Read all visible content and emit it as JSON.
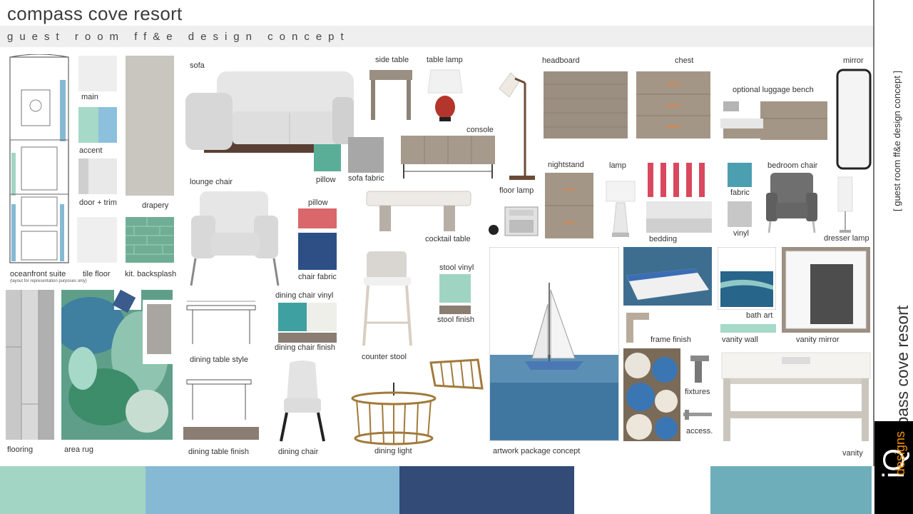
{
  "header": {
    "title": "compass cove resort",
    "subtitle": "guest room ff&e design concept"
  },
  "side": {
    "title": "compass cove resort",
    "subtitle": "[ guest room ff&e design concept ]",
    "logo_main": "iQ",
    "logo_sub": "designs"
  },
  "labels": {
    "main": "main",
    "accent": "accent",
    "door_trim": "door + trim",
    "drapery": "drapery",
    "tile_floor": "tile floor",
    "kit_backsplash": "kit. backsplash",
    "oceanfront_suite": "oceanfront suite",
    "layout_note": "(layout for representation purposes only)",
    "flooring": "flooring",
    "area_rug": "area rug",
    "sofa": "sofa",
    "pillow": "pillow",
    "sofa_fabric": "sofa fabric",
    "lounge_chair": "lounge chair",
    "pillow2": "pillow",
    "chair_fabric": "chair fabric",
    "side_table": "side table",
    "table_lamp": "table lamp",
    "console": "console",
    "cocktail_table": "cocktail table",
    "floor_lamp": "floor lamp",
    "headboard": "headboard",
    "chest": "chest",
    "optional_luggage_bench": "optional luggage bench",
    "mirror": "mirror",
    "nightstand": "nightstand",
    "lamp": "lamp",
    "bedding": "bedding",
    "fabric": "fabric",
    "vinyl": "vinyl",
    "bedroom_chair": "bedroom chair",
    "dresser_lamp": "dresser lamp",
    "dining_table_style": "dining table style",
    "dining_chair_vinyl": "dining chair vinyl",
    "dining_chair_finish": "dining chair finish",
    "dining_table_finish": "dining table finish",
    "dining_chair": "dining chair",
    "stool_vinyl": "stool vinyl",
    "stool_finish": "stool finish",
    "counter_stool": "counter stool",
    "dining_light": "dining light",
    "artwork_package_concept": "artwork package concept",
    "frame_finish": "frame finish",
    "fixtures": "fixtures",
    "access": "access.",
    "bath_art": "bath art",
    "vanity_wall": "vanity wall",
    "vanity_mirror": "vanity mirror",
    "vanity": "vanity"
  },
  "colors": {
    "main": "#eeeeee",
    "accent_green": "#a6d9c7",
    "accent_blue": "#8cc0dc",
    "door_trim_dark": "#cfcfcf",
    "door_trim_light": "#e9e9e9",
    "drapery": "#c9c5bf",
    "tile_floor": "#eeeeee",
    "kit_backsplash": "#6fae94",
    "palette": [
      "#a3d5c4",
      "#86b9d4",
      "#324b77",
      "#ffffff",
      "#6eaeba"
    ]
  }
}
